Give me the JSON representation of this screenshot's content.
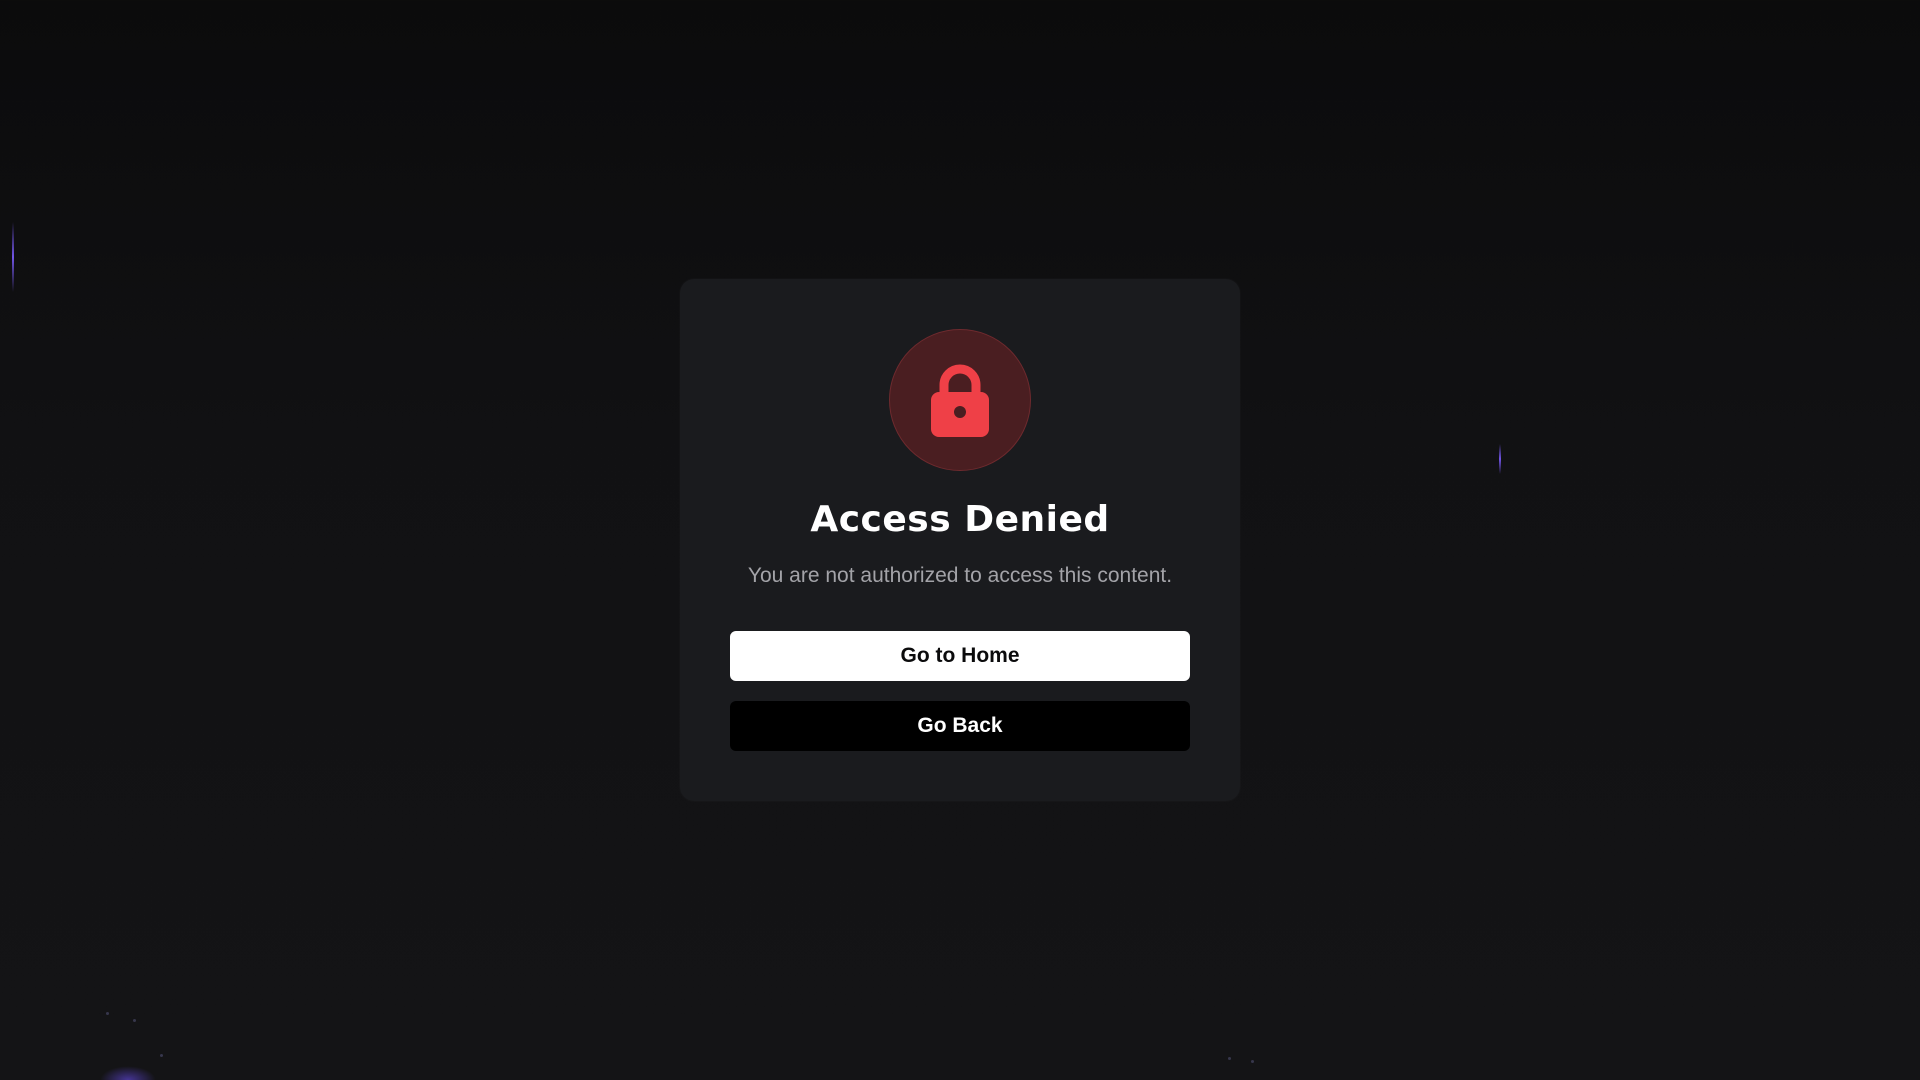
{
  "access_denied": {
    "icon": "lock-icon",
    "title": "Access Denied",
    "message": "You are not authorized to access this content.",
    "home_button_label": "Go to Home",
    "back_button_label": "Go Back"
  },
  "colors": {
    "background": "#0f0f11",
    "card": "#1a1b1e",
    "lock_accent": "#ef4047",
    "lock_circle": "#4a1e21",
    "accent_glow": "#7c5cff"
  }
}
